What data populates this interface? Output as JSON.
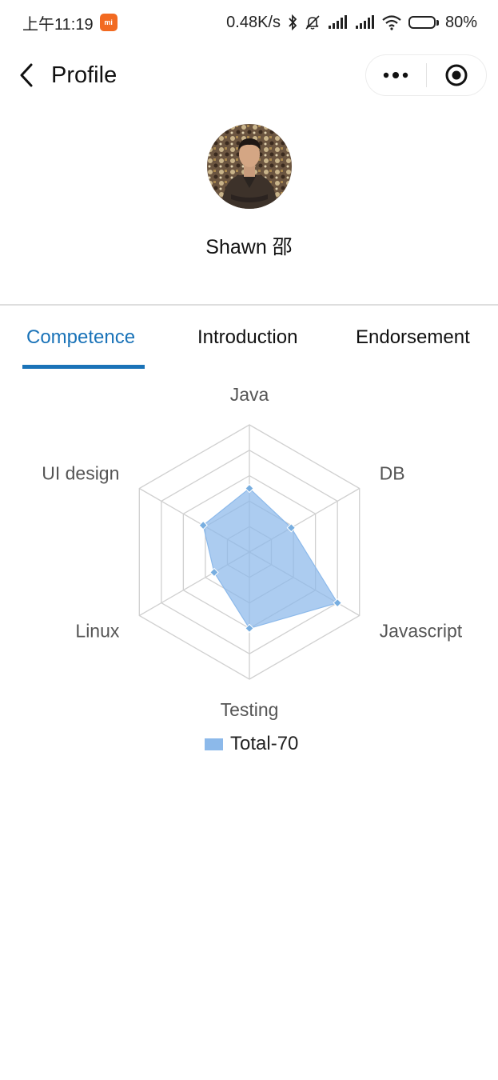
{
  "status_bar": {
    "time": "上午11:19",
    "app_badge": "mi",
    "speed": "0.48K/s",
    "battery": "80%",
    "battery_level": 0.8
  },
  "nav": {
    "title": "Profile"
  },
  "profile": {
    "name": "Shawn 邵"
  },
  "tabs": [
    {
      "label": "Competence",
      "active": true
    },
    {
      "label": "Introduction",
      "active": false
    },
    {
      "label": "Endorsement",
      "active": false
    }
  ],
  "colors": {
    "accent": "#1a73b8",
    "series_fill": "#8cb9ea",
    "series_point": "#78aee0",
    "grid": "#d0d0d0",
    "axis_label": "#555555"
  },
  "chart_data": {
    "type": "radar",
    "categories": [
      "Java",
      "DB",
      "Javascript",
      "Testing",
      "Linux",
      "UI design"
    ],
    "max": 5,
    "levels": 5,
    "grid": true,
    "legend_position": "bottom",
    "series": [
      {
        "name": "Total-70",
        "values": [
          2.5,
          1.9,
          4.0,
          3.0,
          1.6,
          2.1
        ]
      }
    ]
  }
}
